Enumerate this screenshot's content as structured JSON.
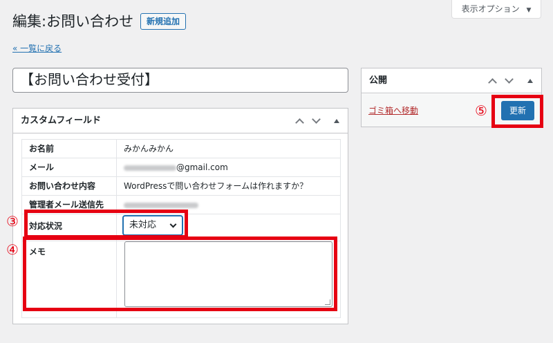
{
  "header": {
    "title": "編集:お問い合わせ",
    "add_new_label": "新規追加",
    "screen_options_label": "表示オプション",
    "back_link": "« 一覧に戻る"
  },
  "post": {
    "title_value": "【お問い合わせ受付】"
  },
  "custom_fields": {
    "title": "カスタムフィールド",
    "rows": [
      {
        "label": "お名前",
        "value": "みかんみかん"
      },
      {
        "label": "メール",
        "value": "@gmail.com"
      },
      {
        "label": "お問い合わせ内容",
        "value": "WordPressで問い合わせフォームは作れますか？"
      },
      {
        "label": "管理者メール送信先",
        "value": ""
      },
      {
        "label": "対応状況",
        "select_value": "未対応"
      },
      {
        "label": "メモ",
        "textarea_value": ""
      }
    ]
  },
  "publish": {
    "title": "公開",
    "trash_label": "ゴミ箱へ移動",
    "update_label": "更新"
  },
  "annotations": {
    "status": "③",
    "memo": "④",
    "update": "⑤"
  },
  "colors": {
    "accent": "#2271b1",
    "annotation_red": "#e60012",
    "trash_red": "#b32d2e",
    "background": "#f0f0f1"
  },
  "icons": [
    "chevron-up-icon",
    "chevron-down-icon",
    "toggle-triangle-icon",
    "dropdown-arrow-icon",
    "resize-handle-icon"
  ]
}
